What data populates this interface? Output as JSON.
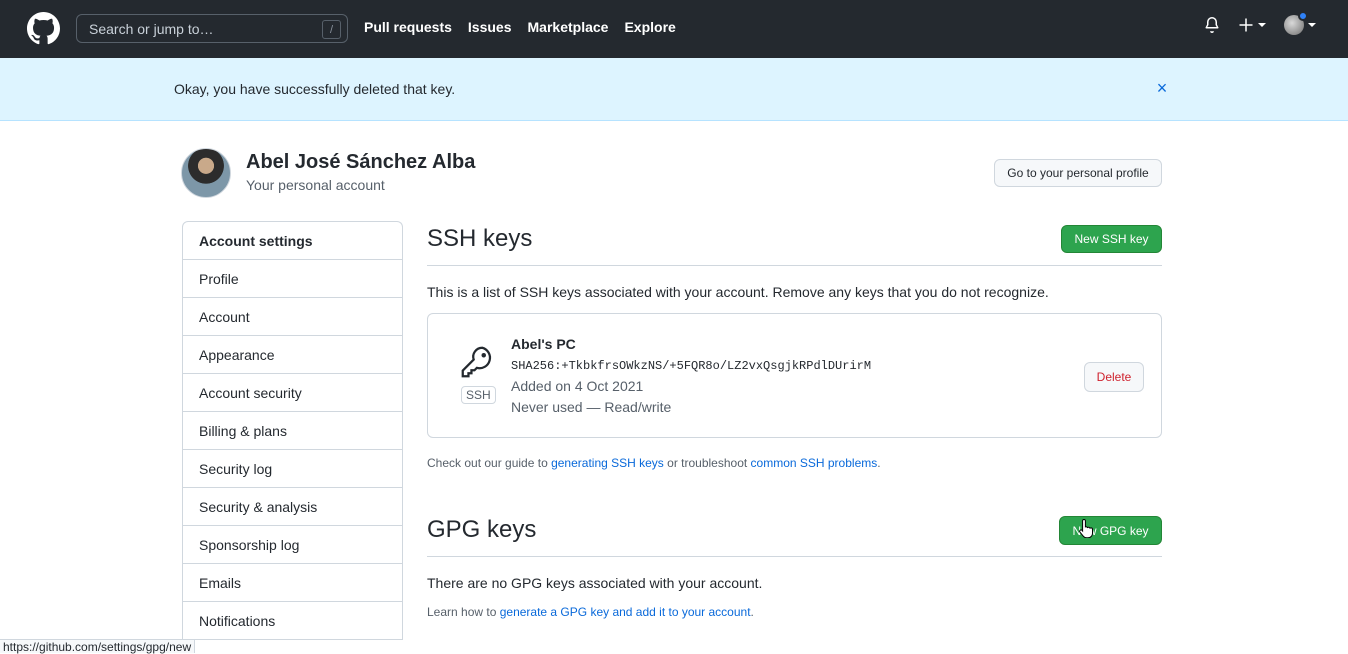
{
  "header": {
    "search_placeholder": "Search or jump to…",
    "search_shortcut": "/",
    "nav": [
      "Pull requests",
      "Issues",
      "Marketplace",
      "Explore"
    ],
    "icons": [
      "github-logo-icon",
      "bell-icon",
      "plus-icon",
      "avatar"
    ]
  },
  "flash": {
    "message": "Okay, you have successfully deleted that key.",
    "close": "×"
  },
  "profile": {
    "name": "Abel José Sánchez Alba",
    "subtitle": "Your personal account",
    "go_profile_label": "Go to your personal profile"
  },
  "sidebar": {
    "heading": "Account settings",
    "items": [
      {
        "label": "Profile"
      },
      {
        "label": "Account"
      },
      {
        "label": "Appearance"
      },
      {
        "label": "Account security"
      },
      {
        "label": "Billing & plans"
      },
      {
        "label": "Security log"
      },
      {
        "label": "Security & analysis"
      },
      {
        "label": "Sponsorship log"
      },
      {
        "label": "Emails"
      },
      {
        "label": "Notifications"
      }
    ]
  },
  "ssh": {
    "title": "SSH keys",
    "new_label": "New SSH key",
    "description": "This is a list of SSH keys associated with your account. Remove any keys that you do not recognize.",
    "key": {
      "badge": "SSH",
      "name": "Abel's PC",
      "fingerprint": "SHA256:+TkbkfrsOWkzNS/+5FQR8o/LZ2vxQsgjkRPdlDUrirM",
      "added": "Added on 4 Oct 2021",
      "usage": "Never used — Read/write",
      "delete_label": "Delete"
    },
    "guide_prefix": "Check out our guide to ",
    "guide_link1": "generating SSH keys",
    "guide_mid": " or troubleshoot ",
    "guide_link2": "common SSH problems",
    "guide_suffix": "."
  },
  "gpg": {
    "title": "GPG keys",
    "new_label": "New GPG key",
    "empty": "There are no GPG keys associated with your account.",
    "learn_prefix": "Learn how to ",
    "learn_link": "generate a GPG key and add it to your account",
    "learn_suffix": "."
  },
  "statusbar": {
    "url": "https://github.com/settings/gpg/new"
  }
}
